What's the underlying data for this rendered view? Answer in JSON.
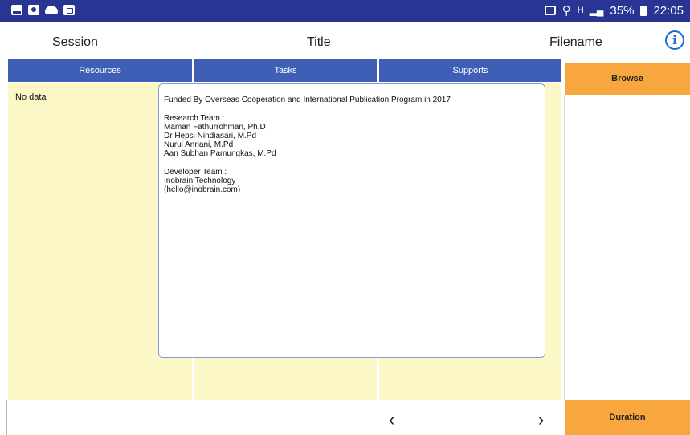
{
  "status_bar": {
    "left_icons": [
      "image-icon",
      "camera-icon",
      "cloud-icon",
      "bag-icon"
    ],
    "nfc_icon": "nfc-icon",
    "location_icon": "location-icon",
    "network": "H",
    "battery": "35%",
    "time": "22:05"
  },
  "header": {
    "session": "Session",
    "title": "Title",
    "filename": "Filename",
    "info_icon": "i"
  },
  "tabs": [
    {
      "label": "Resources"
    },
    {
      "label": "Tasks"
    },
    {
      "label": "Supports"
    }
  ],
  "resources": {
    "empty_text": "No data"
  },
  "buttons": {
    "browse": "Browse",
    "duration": "Duration",
    "prev": "‹",
    "next": "›"
  },
  "about": {
    "funding": "Funded By Overseas Cooperation and International Publication Program in 2017",
    "research_heading": "Research Team :",
    "research_team": [
      "Maman Fathurrohman, Ph.D",
      "Dr Hepsi Nindiasari, M.Pd",
      "Nurul Anriani, M.Pd",
      "Aan Subhan Pamungkas, M.Pd"
    ],
    "developer_heading": "Developer Team :",
    "developer_team": [
      "Inobrain Technology",
      "(hello@inobrain.com)"
    ]
  },
  "colors": {
    "status_bar": "#283593",
    "tab": "#3f5eb5",
    "column_bg": "#fbf7c6",
    "orange_button": "#f7a73d",
    "info_blue": "#1e6bd6"
  }
}
